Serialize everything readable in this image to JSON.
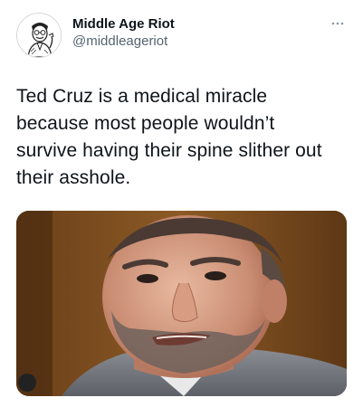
{
  "tweet": {
    "author": {
      "display_name": "Middle Age Riot",
      "handle": "@middleageriot",
      "avatar_icon": "cartoon-man-portrait-icon"
    },
    "more_icon": "more-options-icon",
    "text": "Ted Cruz is a medical miracle\nbecause most people wouldn’t\nsurvive having their spine slither out\ntheir asshole.",
    "media": {
      "kind": "photo",
      "subject": "man-portrait-photo"
    }
  },
  "colors": {
    "text_primary": "#0f1419",
    "text_secondary": "#536471",
    "background": "#ffffff"
  }
}
